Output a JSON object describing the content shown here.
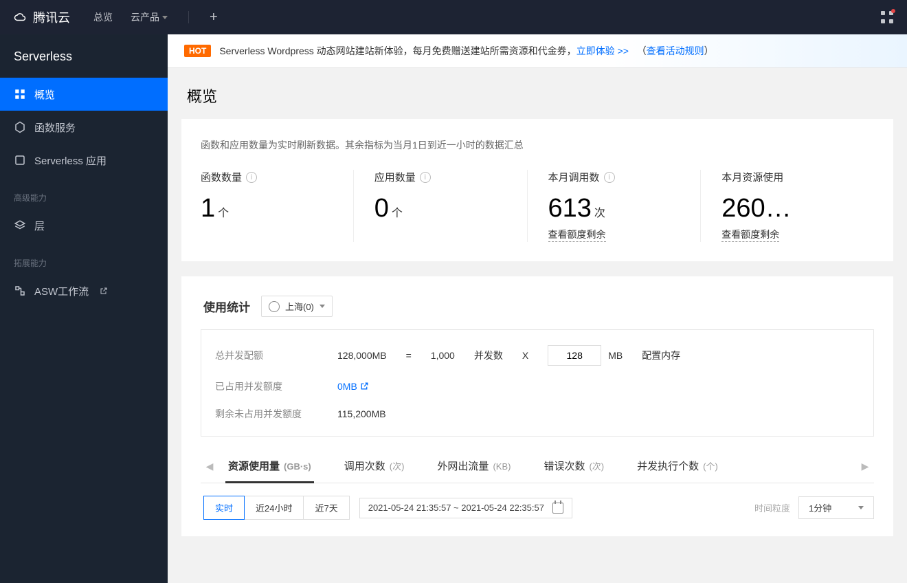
{
  "topnav": {
    "brand": "腾讯云",
    "overview": "总览",
    "products": "云产品"
  },
  "sidebar": {
    "title": "Serverless",
    "items": [
      {
        "label": "概览"
      },
      {
        "label": "函数服务"
      },
      {
        "label": "Serverless 应用"
      }
    ],
    "section_adv": "高级能力",
    "item_layers": "层",
    "section_ext": "拓展能力",
    "item_asw": "ASW工作流"
  },
  "banner": {
    "hot": "HOT",
    "text": "Serverless Wordpress 动态网站建站新体验，每月免费赠送建站所需资源和代金券，",
    "link1": "立即体验 >>",
    "paren_l": "（",
    "link2": "查看活动规则",
    "paren_r": "）"
  },
  "page_title": "概览",
  "stats": {
    "note": "函数和应用数量为实时刷新数据。其余指标为当月1日到近一小时的数据汇总",
    "items": [
      {
        "label": "函数数量",
        "value": "1",
        "unit": "个",
        "info": true
      },
      {
        "label": "应用数量",
        "value": "0",
        "unit": "个",
        "info": true
      },
      {
        "label": "本月调用数",
        "value": "613",
        "unit": "次",
        "info": true,
        "quota": "查看额度剩余"
      },
      {
        "label": "本月资源使用",
        "value": "260…",
        "unit": "",
        "info": false,
        "quota": "查看额度剩余"
      }
    ]
  },
  "usage": {
    "title": "使用统计",
    "region": "上海(0)",
    "rows": {
      "total_label": "总并发配额",
      "total_value": "128,000MB",
      "eq": "=",
      "conc_count": "1,000",
      "conc_label": "并发数",
      "times": "X",
      "mem_value": "128",
      "mem_unit": "MB",
      "mem_label": "配置内存",
      "used_label": "已占用并发额度",
      "used_value": "0MB",
      "remain_label": "剩余未占用并发额度",
      "remain_value": "115,200MB"
    },
    "tabs": [
      {
        "label": "资源使用量",
        "unit": "(GB·s)",
        "active": true
      },
      {
        "label": "调用次数",
        "unit": "(次)"
      },
      {
        "label": "外网出流量",
        "unit": "(KB)"
      },
      {
        "label": "错误次数",
        "unit": "(次)"
      },
      {
        "label": "并发执行个数",
        "unit": "(个)"
      }
    ],
    "time": {
      "segments": [
        "实时",
        "近24小时",
        "近7天"
      ],
      "range": "2021-05-24 21:35:57 ~ 2021-05-24 22:35:57",
      "gran_label": "时间粒度",
      "gran_value": "1分钟"
    }
  }
}
